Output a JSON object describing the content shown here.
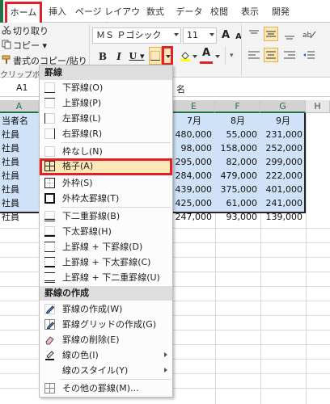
{
  "ribbon_tabs": [
    "ホーム",
    "挿入",
    "ページ レイアウト",
    "数式",
    "データ",
    "校閲",
    "表示",
    "開発"
  ],
  "clipboard": {
    "cut_label": "切り取り",
    "copy_label": "コピー ▾",
    "format_painter_label": "書式のコピー/貼り付け",
    "group_label": "クリップボード"
  },
  "font": {
    "name": "ＭＳ Ｐゴシック",
    "size": "11",
    "bold_label": "B",
    "italic_label": "I",
    "underline_label": "U ▾",
    "grow_label": "A",
    "shrink_label": "A"
  },
  "name_box": "A1",
  "formula_fragment": "名",
  "columns": [
    "A",
    "E",
    "F",
    "G",
    "H"
  ],
  "rows": [
    {
      "a": "当者名",
      "e": "7月",
      "f": "8月",
      "g": "9月"
    },
    {
      "a": "社員",
      "e": "480,000",
      "f": "55,000",
      "g": "231,000"
    },
    {
      "a": "社員",
      "e": "98,000",
      "f": "158,000",
      "g": "252,000"
    },
    {
      "a": "社員",
      "e": "295,000",
      "f": "82,000",
      "g": "299,000"
    },
    {
      "a": "社員",
      "e": "284,000",
      "f": "479,000",
      "g": "222,000"
    },
    {
      "a": "社員",
      "e": "439,000",
      "f": "375,000",
      "g": "401,000"
    },
    {
      "a": "社員",
      "e": "425,000",
      "f": "61,000",
      "g": "241,000"
    },
    {
      "a": "社員",
      "e": "247,000",
      "f": "93,000",
      "g": "139,000"
    }
  ],
  "menu": {
    "section1": "罫線",
    "items1": [
      {
        "icon": "bottom-border-icon",
        "label": "下罫線(O)"
      },
      {
        "icon": "top-border-icon",
        "label": "上罫線(P)"
      },
      {
        "icon": "left-border-icon",
        "label": "左罫線(L)"
      },
      {
        "icon": "right-border-icon",
        "label": "右罫線(R)"
      },
      {
        "icon": "no-border-icon",
        "label": "枠なし(N)"
      },
      {
        "icon": "all-borders-icon",
        "label": "格子(A)"
      },
      {
        "icon": "outside-borders-icon",
        "label": "外枠(S)"
      },
      {
        "icon": "thick-box-border-icon",
        "label": "外枠太罫線(T)"
      },
      {
        "icon": "bottom-double-border-icon",
        "label": "下二重罫線(B)"
      },
      {
        "icon": "thick-bottom-border-icon",
        "label": "下太罫線(H)"
      },
      {
        "icon": "top-bottom-border-icon",
        "label": "上罫線 + 下罫線(D)"
      },
      {
        "icon": "top-thick-bottom-border-icon",
        "label": "上罫線 + 下太罫線(C)"
      },
      {
        "icon": "top-double-bottom-border-icon",
        "label": "上罫線 + 下二重罫線(U)"
      }
    ],
    "section2": "罫線の作成",
    "items2": [
      {
        "icon": "draw-border-icon",
        "label": "罫線の作成(W)"
      },
      {
        "icon": "draw-border-grid-icon",
        "label": "罫線グリッドの作成(G)"
      },
      {
        "icon": "erase-border-icon",
        "label": "罫線の削除(E)"
      },
      {
        "icon": "line-color-icon",
        "label": "線の色(I)"
      },
      {
        "icon": "line-style-icon",
        "label": "線のスタイル(Y)"
      },
      {
        "icon": "more-borders-icon",
        "label": "その他の罫線(M)..."
      }
    ]
  },
  "colors": {
    "highlight_red": "#e0202a",
    "selection_blue": "#cfe2f7",
    "excel_green": "#217346"
  }
}
